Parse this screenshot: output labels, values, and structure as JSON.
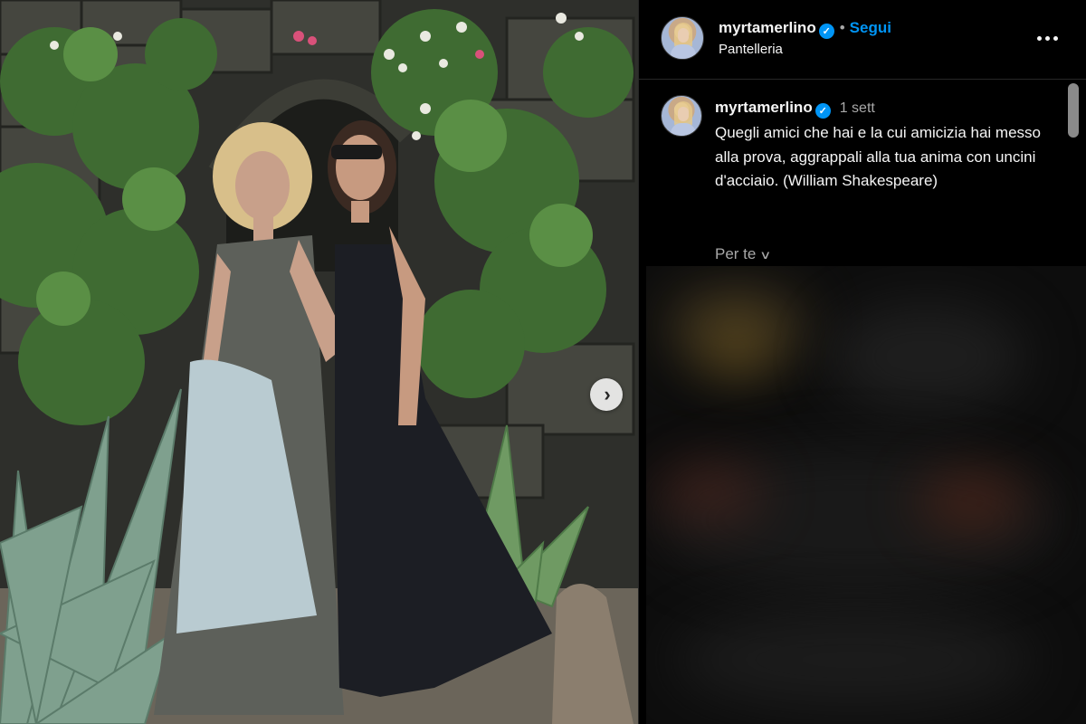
{
  "post": {
    "username": "myrtamerlino",
    "verified": true,
    "follow_label": "Segui",
    "location": "Pantelleria",
    "more_icon": "more-horizontal-icon"
  },
  "caption": {
    "username": "myrtamerlino",
    "time": "1 sett",
    "text": "Quegli amici che hai e la cui amicizia hai messo alla prova, aggrappali alla tua anima con uncini d'acciaio. (William Shakespeare)"
  },
  "feed_filter": {
    "label": "Per te",
    "icon": "chevron-down-icon"
  },
  "carousel": {
    "next_icon": "chevron-right-icon"
  },
  "colors": {
    "accent": "#0095f6",
    "background": "#000000",
    "muted_text": "#a8a8a8",
    "border": "#262626"
  }
}
